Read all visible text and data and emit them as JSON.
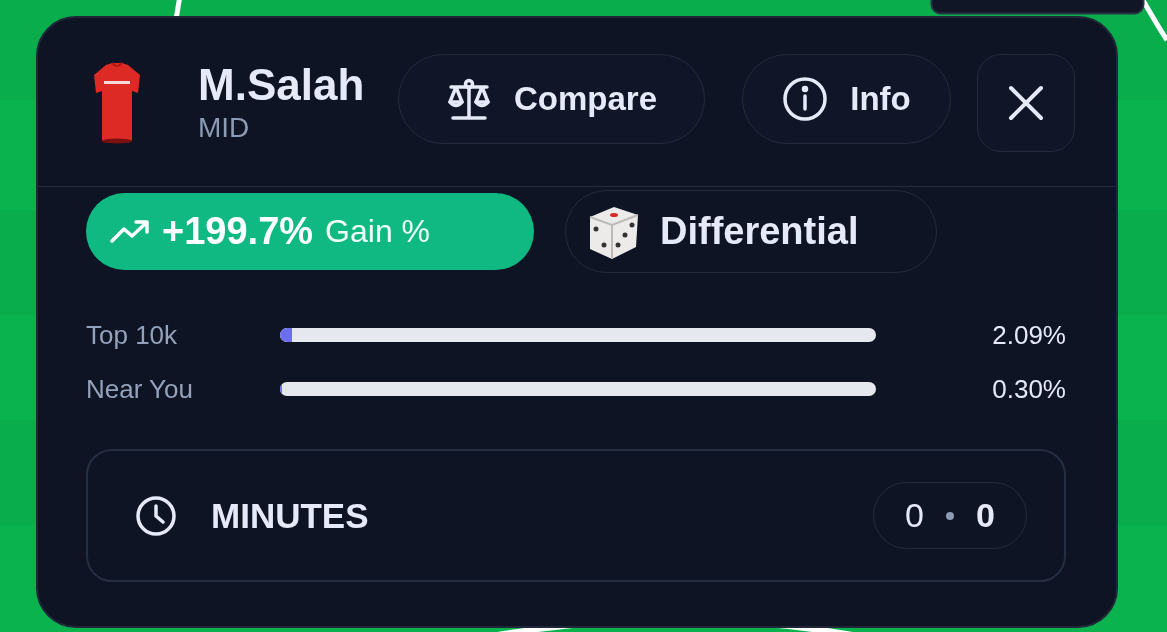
{
  "player": {
    "name": "M.Salah",
    "position": "MID"
  },
  "actions": [
    {
      "kind": "compare",
      "label": "Compare"
    },
    {
      "kind": "info",
      "label": "Info"
    },
    {
      "kind": "close"
    }
  ],
  "gain": {
    "value": "+199.7%",
    "label": "Gain %"
  },
  "tag": {
    "label": "Differential"
  },
  "ownership": [
    {
      "label": "Top 10k",
      "level": 0.0209,
      "reading": "2.09%"
    },
    {
      "label": "Near You",
      "level": 0.003,
      "reading": "0.30%"
    }
  ],
  "stat": {
    "label": "MINUTES",
    "values": [
      "0",
      "0"
    ]
  }
}
